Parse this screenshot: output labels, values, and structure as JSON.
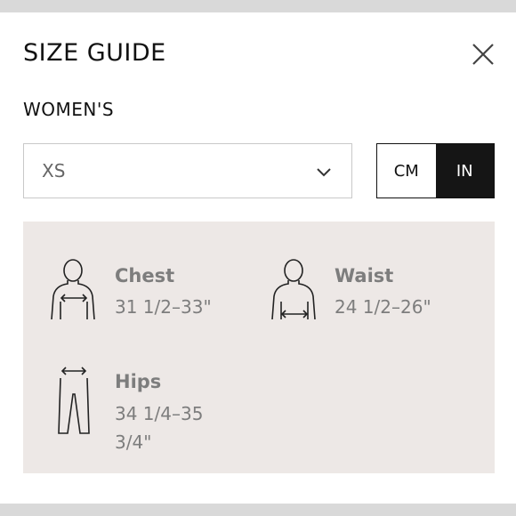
{
  "header": {
    "title": "SIZE GUIDE"
  },
  "section": {
    "title": "WOMEN'S"
  },
  "size_select": {
    "value": "XS"
  },
  "units": {
    "cm": "CM",
    "in": "IN",
    "selected": "IN"
  },
  "measurements": [
    {
      "label": "Chest",
      "value": "31 1/2–33\"",
      "icon": "chest-icon"
    },
    {
      "label": "Waist",
      "value": "24 1/2–26\"",
      "icon": "waist-icon"
    },
    {
      "label": "Hips",
      "value_line1": "34 1/4–35",
      "value_line2": "3/4\"",
      "icon": "hips-icon"
    }
  ],
  "colors": {
    "selected_unit_bg": "#151515",
    "measure_bg": "#ede8e6",
    "text_muted": "#7d7d7d"
  }
}
